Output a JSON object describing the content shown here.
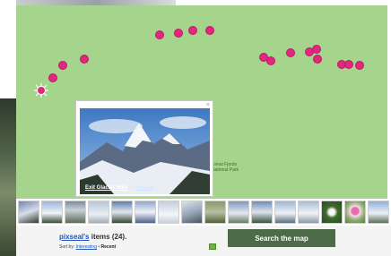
{
  "popup": {
    "close_glyph": "×",
    "title": "Exit Glacier Hike",
    "by_label": "by",
    "user": "pixseal"
  },
  "map": {
    "label_line1": "Kenai Fjords",
    "label_line2": "National Park"
  },
  "gallery": {
    "owner": "pixseal's",
    "count_text": "items (24).",
    "sort_label": "Sort by:",
    "sort_interesting": "Interesting",
    "sort_separator": "•",
    "sort_recent": "Recent",
    "search_button": "Search the map"
  },
  "colors": {
    "map_green": "#a5d58c",
    "pin_pink": "#e0287d",
    "button_dark_green": "#4d6b49",
    "link_blue": "#1f56b8"
  }
}
